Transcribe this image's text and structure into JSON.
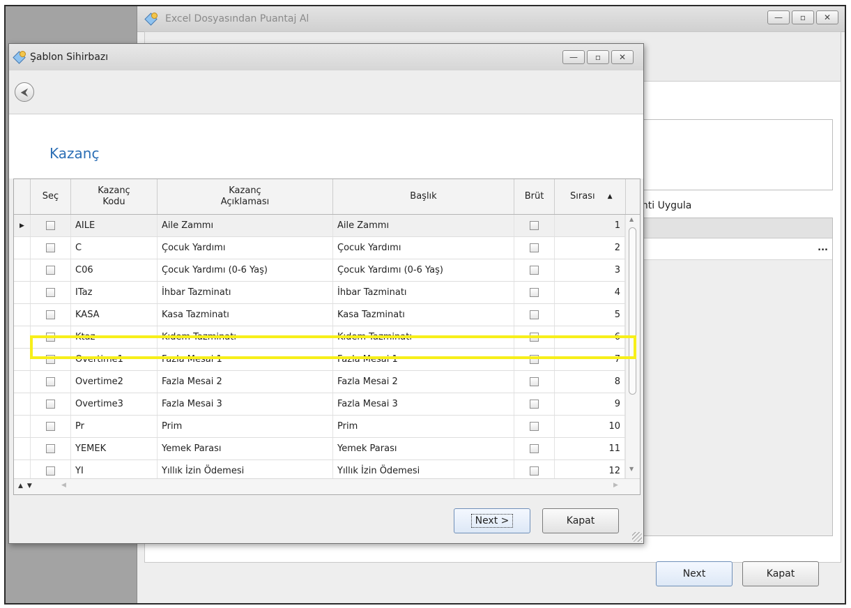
{
  "background_window": {
    "title": "Excel Dosyasından Puantaj Al",
    "partial_label": "inti Uygula",
    "grid_button": "...",
    "next_label": "Next",
    "close_label": "Kapat"
  },
  "dialog": {
    "title": "Şablon Sihirbazı",
    "back_icon": "back-arrow-icon",
    "section_title": "Kazanç",
    "columns": [
      "Seç",
      "Kazanç\nKodu",
      "Kazanç\nAçıklaması",
      "Başlık",
      "Brüt",
      "Sırası"
    ],
    "sort_indicator": "▲",
    "rows": [
      {
        "code": "AILE",
        "desc": "Aile Zammı",
        "title": "Aile Zammı",
        "order": "1"
      },
      {
        "code": "C",
        "desc": "Çocuk Yardımı",
        "title": "Çocuk Yardımı",
        "order": "2"
      },
      {
        "code": "C06",
        "desc": "Çocuk Yardımı (0-6 Yaş)",
        "title": "Çocuk Yardımı (0-6 Yaş)",
        "order": "3"
      },
      {
        "code": "ITaz",
        "desc": "İhbar Tazminatı",
        "title": "İhbar Tazminatı",
        "order": "4"
      },
      {
        "code": "KASA",
        "desc": "Kasa Tazminatı",
        "title": "Kasa Tazminatı",
        "order": "5"
      },
      {
        "code": "Ktaz",
        "desc": "Kıdem Tazminatı",
        "title": "Kıdem Tazminatı",
        "order": "6"
      },
      {
        "code": "Overtime1",
        "desc": "Fazla Mesai 1",
        "title": "Fazla Mesai 1",
        "order": "7"
      },
      {
        "code": "Overtime2",
        "desc": "Fazla Mesai 2",
        "title": "Fazla Mesai 2",
        "order": "8"
      },
      {
        "code": "Overtime3",
        "desc": "Fazla Mesai 3",
        "title": "Fazla Mesai 3",
        "order": "9"
      },
      {
        "code": "Pr",
        "desc": "Prim",
        "title": "Prim",
        "order": "10"
      },
      {
        "code": "YEMEK",
        "desc": "Yemek Parası",
        "title": "Yemek Parası",
        "order": "11"
      },
      {
        "code": "YI",
        "desc": "Yıllık İzin Ödemesi",
        "title": "Yıllık İzin Ödemesi",
        "order": "12"
      }
    ],
    "highlighted_code": "KASA",
    "next_label": "Next >",
    "close_label": "Kapat"
  },
  "colors": {
    "accent": "#2c6fb5",
    "highlight": "#f7ef1a"
  }
}
